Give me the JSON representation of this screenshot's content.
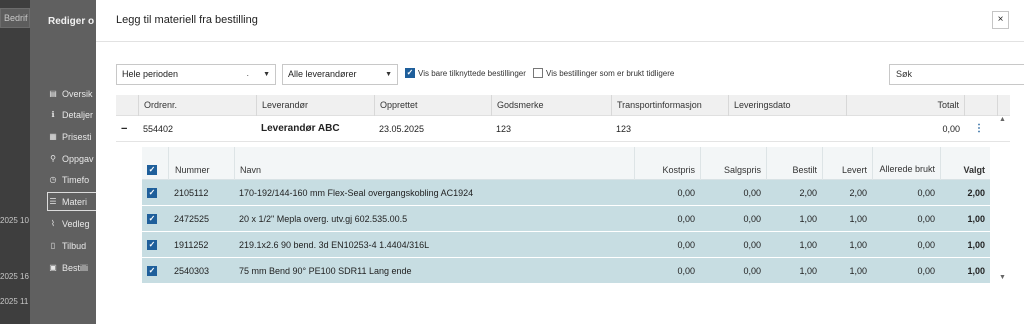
{
  "background": {
    "search_fragment": "Bedrif",
    "dates": [
      "2025 10",
      "2025 16",
      "2025 11"
    ],
    "panel_title": "Rediger o",
    "nav": [
      {
        "label": "Oversik",
        "icon": "list-icon"
      },
      {
        "label": "Detaljer",
        "icon": "info-icon"
      },
      {
        "label": "Prisesti",
        "icon": "money-icon"
      },
      {
        "label": "Oppgav",
        "icon": "pin-icon"
      },
      {
        "label": "Timefo",
        "icon": "clock-icon"
      },
      {
        "label": "Materi",
        "icon": "list-lines-icon"
      },
      {
        "label": "Vedleg",
        "icon": "paperclip-icon"
      },
      {
        "label": "Tilbud",
        "icon": "document-icon"
      },
      {
        "label": "Bestilli",
        "icon": "bag-icon"
      }
    ]
  },
  "modal": {
    "title": "Legg til materiell fra bestilling",
    "close": "×"
  },
  "filters": {
    "period": "Hele perioden",
    "supplier": "Alle leverandører",
    "only_linked_label": "Vis bare tilknyttede bestillinger",
    "only_linked_checked": true,
    "show_used_label": "Vis bestillinger som er brukt tidligere",
    "show_used_checked": false,
    "search_placeholder": "Søk"
  },
  "orders_table": {
    "columns": [
      "Ordrenr.",
      "Leverandør",
      "Opprettet",
      "Godsmerke",
      "Transportinformasjon",
      "Leveringsdato",
      "Totalt"
    ],
    "row": {
      "order_no": "554402",
      "supplier": "Leverandør ABC",
      "created": "23.05.2025",
      "godsmerke": "123",
      "transport": "123",
      "delivery_date": "",
      "total": "0,00"
    }
  },
  "items_table": {
    "columns": {
      "number": "Nummer",
      "name": "Navn",
      "cost": "Kostpris",
      "sale": "Salgspris",
      "ordered": "Bestilt",
      "delivered": "Levert",
      "used": "Allerede brukt",
      "selected": "Valgt"
    },
    "rows": [
      {
        "number": "2105112",
        "name": "170-192/144-160 mm Flex-Seal overgangskobling AC1924",
        "cost": "0,00",
        "sale": "0,00",
        "ordered": "2,00",
        "delivered": "2,00",
        "used": "0,00",
        "selected": "2,00"
      },
      {
        "number": "2472525",
        "name": "20 x 1/2\" Mepla overg. utv.gj 602.535.00.5",
        "cost": "0,00",
        "sale": "0,00",
        "ordered": "1,00",
        "delivered": "1,00",
        "used": "0,00",
        "selected": "1,00"
      },
      {
        "number": "1911252",
        "name": "219.1x2.6 90 bend. 3d EN10253-4 1.4404/316L",
        "cost": "0,00",
        "sale": "0,00",
        "ordered": "1,00",
        "delivered": "1,00",
        "used": "0,00",
        "selected": "1,00"
      },
      {
        "number": "2540303",
        "name": "75 mm Bend 90° PE100 SDR11 Lang ende",
        "cost": "0,00",
        "sale": "0,00",
        "ordered": "1,00",
        "delivered": "1,00",
        "used": "0,00",
        "selected": "1,00"
      }
    ]
  }
}
